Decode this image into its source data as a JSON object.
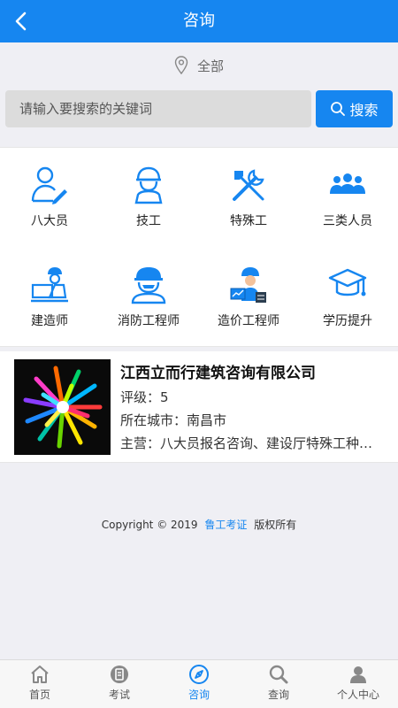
{
  "header": {
    "title": "咨询"
  },
  "location": {
    "label": "全部"
  },
  "search": {
    "placeholder": "请输入要搜索的关键词",
    "button_label": "搜索"
  },
  "categories": [
    {
      "label": "八大员",
      "icon": "person-pen-icon"
    },
    {
      "label": "技工",
      "icon": "worker-icon"
    },
    {
      "label": "特殊工",
      "icon": "tools-icon"
    },
    {
      "label": "三类人员",
      "icon": "group-icon"
    },
    {
      "label": "建造师",
      "icon": "builder-desk-icon"
    },
    {
      "label": "消防工程师",
      "icon": "fire-engineer-icon"
    },
    {
      "label": "造价工程师",
      "icon": "cost-engineer-icon"
    },
    {
      "label": "学历提升",
      "icon": "graduation-cap-icon"
    }
  ],
  "company": {
    "name": "江西立而行建筑咨询有限公司",
    "rating": "评级：5",
    "city": "所在城市：南昌市",
    "business": "主营：八大员报名咨询、建设厅特殊工种…"
  },
  "footer": {
    "copyright_prefix": "Copyright © 2019",
    "brand": "鲁工考证",
    "copyright_suffix": "版权所有"
  },
  "tabs": [
    {
      "label": "首页",
      "icon": "home-icon"
    },
    {
      "label": "考试",
      "icon": "exam-icon"
    },
    {
      "label": "咨询",
      "icon": "compass-icon",
      "active": true
    },
    {
      "label": "查询",
      "icon": "search-icon"
    },
    {
      "label": "个人中心",
      "icon": "user-icon"
    }
  ],
  "colors": {
    "primary": "#1686f0",
    "background": "#efeff4",
    "inactive_tab": "#888888"
  }
}
